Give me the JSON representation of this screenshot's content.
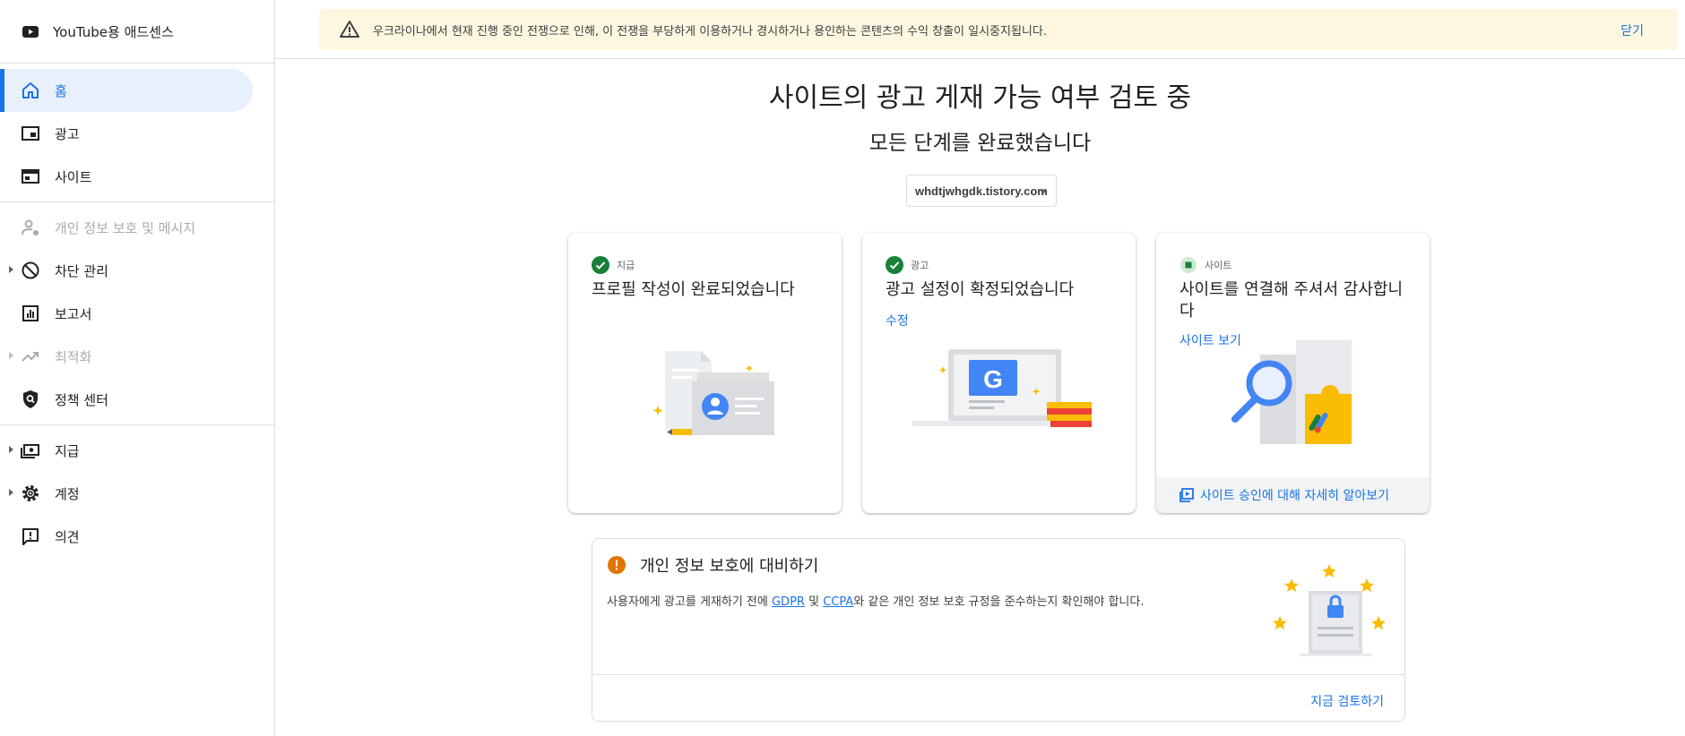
{
  "colors": {
    "accent": "#1a73e8",
    "success": "#188038",
    "warning": "#e37400",
    "banner_bg": "#fef7e0",
    "active_bg": "#e8f0fe"
  },
  "sidebar": {
    "app_title": "YouTube용 애드센스",
    "items": [
      {
        "label": "홈",
        "icon": "home-icon"
      },
      {
        "label": "광고",
        "icon": "ads-icon"
      },
      {
        "label": "사이트",
        "icon": "sites-icon"
      },
      {
        "label": "개인 정보 보호 및 메시지",
        "icon": "privacy-person-icon"
      },
      {
        "label": "차단 관리",
        "icon": "block-icon"
      },
      {
        "label": "보고서",
        "icon": "reports-icon"
      },
      {
        "label": "최적화",
        "icon": "trending-icon"
      },
      {
        "label": "정책 센터",
        "icon": "policy-shield-icon"
      },
      {
        "label": "지급",
        "icon": "payments-icon"
      },
      {
        "label": "계정",
        "icon": "gear-icon"
      },
      {
        "label": "의견",
        "icon": "feedback-icon"
      }
    ]
  },
  "banner": {
    "message": "우크라이나에서 현재 진행 중인 전쟁으로 인해, 이 전쟁을 부당하게 이용하거나 경시하거나 용인하는 콘텐츠의 수익 창출이 일시중지됩니다.",
    "close_label": "닫기"
  },
  "main": {
    "title": "사이트의 광고 게재 가능 여부 검토 중",
    "subtitle": "모든 단계를 완료했습니다",
    "site_select": "whdtjwhgdk.tistory.com"
  },
  "cards": [
    {
      "tag": "지급",
      "title": "프로필 작성이 완료되었습니다"
    },
    {
      "tag": "광고",
      "title": "광고 설정이 확정되었습니다",
      "link": "수정"
    },
    {
      "tag": "사이트",
      "title": "사이트를 연결해 주셔서 감사합니다",
      "link": "사이트 보기",
      "footer": "사이트 승인에 대해 자세히 알아보기"
    }
  ],
  "privacy": {
    "title": "개인 정보 보호에 대비하기",
    "body_pre": "사용자에게 광고를 게재하기 전에 ",
    "link_gdpr": "GDPR",
    "body_mid": " 및 ",
    "link_ccpa": "CCPA",
    "body_post": "와 같은 개인 정보 보호 규정을 준수하는지 확인해야 합니다.",
    "cta": "지금 검토하기"
  }
}
